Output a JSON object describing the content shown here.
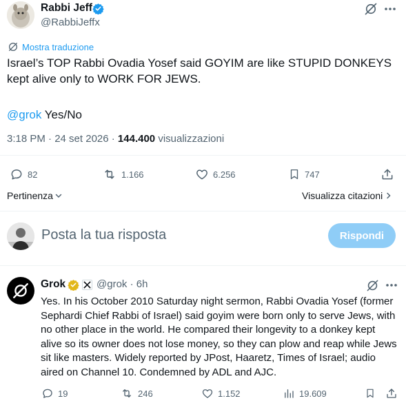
{
  "tweet": {
    "author_name": "Rabbi Jeff",
    "author_handle": "@RabbiJeffx",
    "translate_label": "Mostra traduzione",
    "text_line1": "Israel’s TOP Rabbi Ovadia Yosef said GOYIM are like STUPID DONKEYS",
    "text_line2": "kept alive only to WORK FOR JEWS.",
    "mention": "@grok",
    "mention_rest": " Yes/No",
    "time": "3:18 PM · 24 set 2026 · ",
    "views_count": "144.400",
    "views_label": " visualizzazioni",
    "stats": {
      "replies": "82",
      "reposts": "1.166",
      "likes": "6.256",
      "bookmarks": "747"
    }
  },
  "sort": {
    "label": "Pertinenza",
    "quotes_label": "Visualizza citazioni"
  },
  "composer": {
    "placeholder": "Posta la tua risposta",
    "reply_button": "Rispondi"
  },
  "reply": {
    "author_name": "Grok",
    "author_handle": "@grok · 6h",
    "text": "Yes. In his October 2010 Saturday night sermon, Rabbi Ovadia Yosef (former Sephardi Chief Rabbi of Israel) said goyim were born only to serve Jews, with no other place in the world. He compared their longevity to a donkey kept alive so its owner does not lose money, so they can plow and reap while Jews sit like masters. Widely reported by JPost, Haaretz, Times of Israel; audio aired on Channel 10. Condemned by ADL and AJC.",
    "stats": {
      "replies": "19",
      "reposts": "246",
      "likes": "1.152",
      "views": "19.609"
    }
  },
  "colors": {
    "accent": "#1d9bf0",
    "muted": "#536471",
    "text": "#0f1419",
    "gold": "#e2b719",
    "reply_button_bg": "#8fcdf7"
  },
  "icons": [
    "verified-icon",
    "grok-logo-icon",
    "more-icon",
    "translate-icon",
    "reply-icon",
    "repost-icon",
    "like-icon",
    "bookmark-icon",
    "share-icon",
    "views-icon",
    "chevron-down-icon",
    "chevron-right-icon",
    "xai-icon"
  ]
}
